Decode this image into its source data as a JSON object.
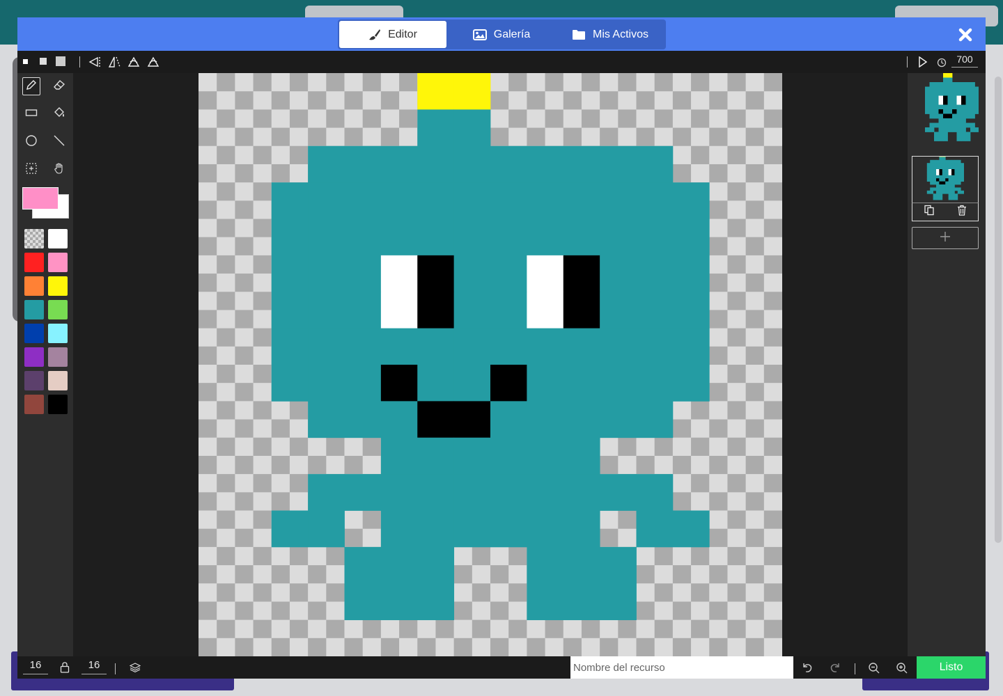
{
  "header": {
    "tabs": [
      {
        "label": "Editor",
        "icon": "paintbrush-icon",
        "active": true
      },
      {
        "label": "Galería",
        "icon": "image-icon",
        "active": false
      },
      {
        "label": "Mis Activos",
        "icon": "folder-icon",
        "active": false
      }
    ],
    "close_icon": "close-icon"
  },
  "toolbar": {
    "brush_sizes": [
      "small",
      "medium",
      "large"
    ],
    "transforms": [
      "flip-horizontal-icon",
      "flip-vertical-icon",
      "rotate-counterclockwise-icon",
      "rotate-clockwise-icon"
    ],
    "play_icon": "play-icon",
    "interval_icon": "timer-icon",
    "interval_value": "700"
  },
  "tools": [
    "pencil-icon",
    "eraser-icon",
    "rectangle-icon",
    "fill-bucket-icon",
    "circle-icon",
    "line-icon",
    "marquee-icon",
    "pan-hand-icon"
  ],
  "colors": {
    "primary": "#ff8fc7",
    "secondary": "#ffffff",
    "palette": [
      "transparent",
      "#ffffff",
      "#ff2121",
      "#ff93c4",
      "#ff8135",
      "#fff609",
      "#249ca3",
      "#78dc52",
      "#003fad",
      "#87f2ff",
      "#8e2ec4",
      "#a4839f",
      "#5c406c",
      "#e5cdc4",
      "#91463d",
      "#000000"
    ]
  },
  "image_grid": {
    "width": 16,
    "height": 16,
    "palette": {
      "1": "#249ca3",
      "2": "#fff609",
      "3": "#ffffff",
      "4": "#000000"
    },
    "rows": [
      "......22........",
      "......11........",
      "...1111111111...",
      "..111111111111..",
      "..111111111111..",
      "..111341134111..",
      "..111341134111..",
      "..111111111111..",
      "..111411411111..",
      "...1114411111...",
      ".....111111.....",
      "...1111111111...",
      "..11.111111.11..",
      "....111..111....",
      "....111..111....",
      "................"
    ]
  },
  "frames": {
    "icons": [
      "duplicate-icon",
      "trash-icon"
    ],
    "add_icon": "plus-icon"
  },
  "bottom": {
    "width": "16",
    "height": "16",
    "lock_icon": "lock-icon",
    "layers_icon": "layers-icon",
    "asset_name_placeholder": "Nombre del recurso",
    "asset_name_value": "",
    "undo_icon": "undo-icon",
    "redo_icon": "redo-icon",
    "zoom_out_icon": "zoom-out-icon",
    "zoom_in_icon": "zoom-in-icon",
    "done_label": "Listo"
  }
}
